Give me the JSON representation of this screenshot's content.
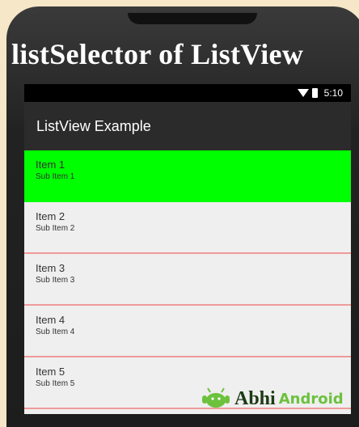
{
  "header": {
    "title": "listSelector of ListView"
  },
  "status_bar": {
    "time": "5:10"
  },
  "action_bar": {
    "title": "ListView Example"
  },
  "list": {
    "items": [
      {
        "title": "Item 1",
        "subtitle": "Sub Item 1",
        "selected": true
      },
      {
        "title": "Item 2",
        "subtitle": "Sub Item 2",
        "selected": false
      },
      {
        "title": "Item 3",
        "subtitle": "Sub Item 3",
        "selected": false
      },
      {
        "title": "Item 4",
        "subtitle": "Sub Item 4",
        "selected": false
      },
      {
        "title": "Item 5",
        "subtitle": "Sub Item 5",
        "selected": false
      }
    ]
  },
  "branding": {
    "logo_text_part1": "Abhi",
    "logo_text_part2": "Android"
  },
  "colors": {
    "selected_bg": "#00ff00",
    "divider": "#f09a9a",
    "action_bar": "#2b2b2b",
    "list_bg": "#efefef"
  }
}
